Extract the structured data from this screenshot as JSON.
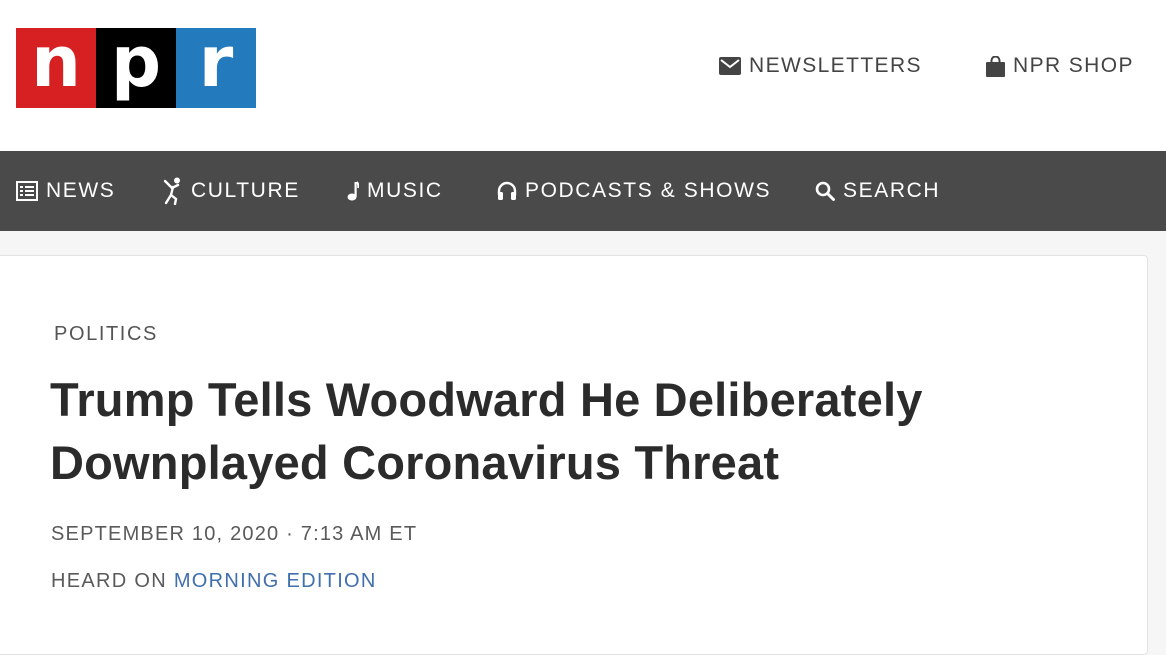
{
  "logo": {
    "letters": [
      "n",
      "p",
      "r"
    ],
    "colors": [
      "#d62021",
      "#000000",
      "#237bbd"
    ]
  },
  "header": {
    "newsletters_label": "NEWSLETTERS",
    "newsletters_icon": "envelope-icon",
    "shop_label": "NPR SHOP",
    "shop_icon": "shopping-bag-icon"
  },
  "nav": {
    "items": [
      {
        "label": "NEWS",
        "icon": "newspaper-icon"
      },
      {
        "label": "CULTURE",
        "icon": "dancer-icon"
      },
      {
        "label": "MUSIC",
        "icon": "music-note-icon"
      },
      {
        "label": "PODCASTS & SHOWS",
        "icon": "headphones-icon"
      },
      {
        "label": "SEARCH",
        "icon": "search-icon"
      }
    ]
  },
  "article": {
    "slug": "POLITICS",
    "headline": "Trump Tells Woodward He Deliberately Downplayed Coronavirus Threat",
    "dateline": "SEPTEMBER 10, 2020 · 7:13 AM ET",
    "heard_on_prefix": "HEARD ON",
    "program": "MORNING EDITION"
  },
  "colors": {
    "nav_bg": "#4a4a4a",
    "link": "#3f6fad"
  }
}
